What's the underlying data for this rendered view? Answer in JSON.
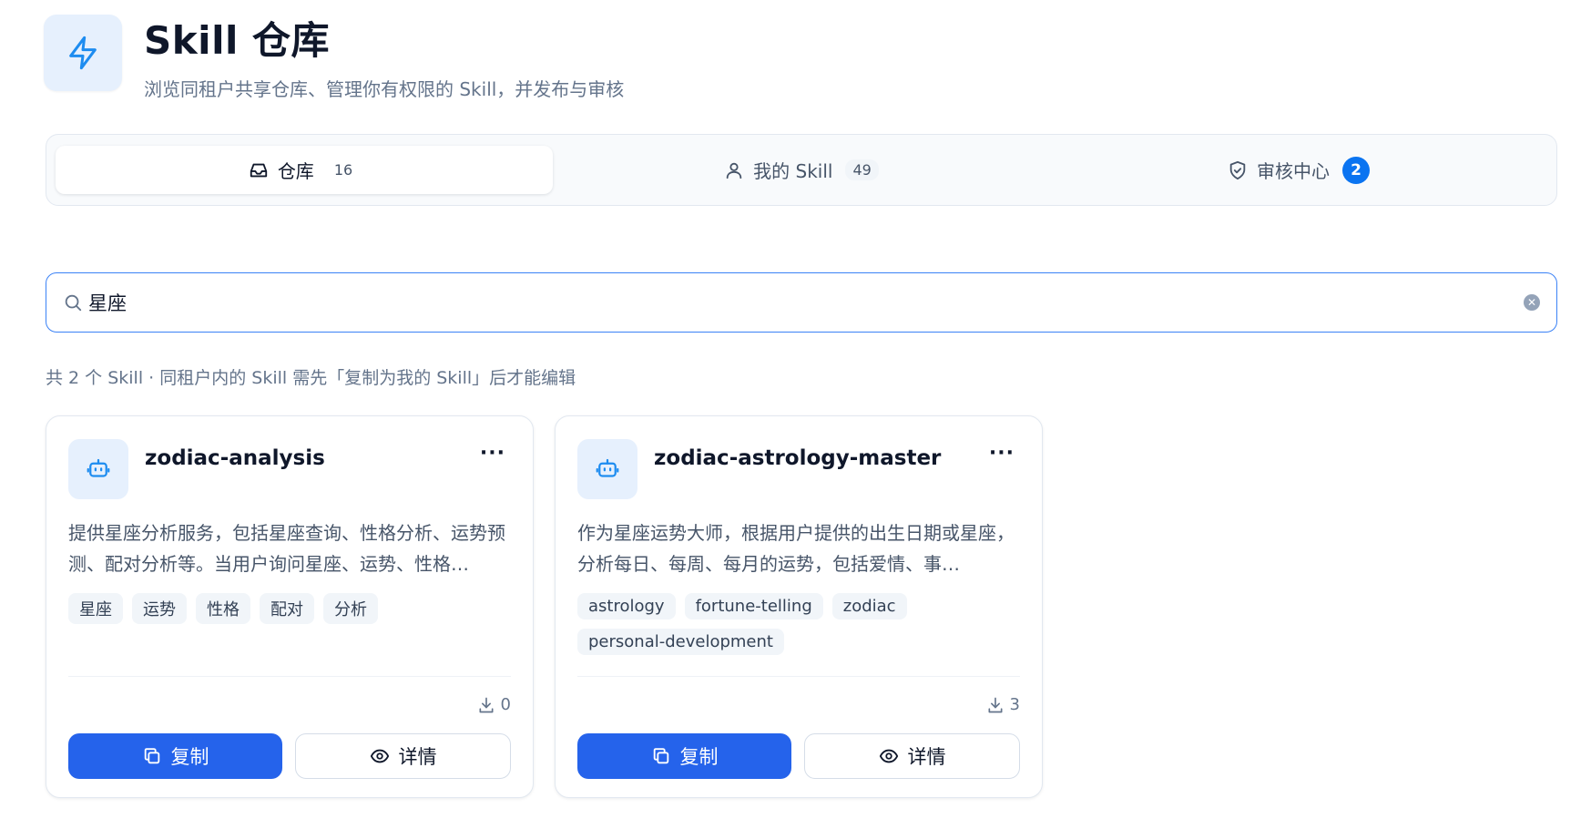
{
  "header": {
    "title": "Skill 仓库",
    "subtitle": "浏览同租户共享仓库、管理你有权限的 Skill，并发布与审核",
    "logo_icon": "lightning-icon"
  },
  "tabs": [
    {
      "label": "仓库",
      "count": "16",
      "icon": "inbox-icon",
      "active": true
    },
    {
      "label": "我的 Skill",
      "count": "49",
      "icon": "user-icon",
      "active": false
    },
    {
      "label": "审核中心",
      "count": "2",
      "icon": "shield-check-icon",
      "active": false
    }
  ],
  "search": {
    "value": "星座",
    "icon": "search-icon",
    "clear_icon": "clear-icon"
  },
  "summary": "共 2 个 Skill · 同租户内的 Skill 需先「复制为我的 Skill」后才能编辑",
  "cards": [
    {
      "name": "zodiac-analysis",
      "icon": "robot-icon",
      "more": "···",
      "description": "提供星座分析服务，包括星座查询、性格分析、运势预测、配对分析等。当用户询问星座、运势、性格…",
      "tags": [
        "星座",
        "运势",
        "性格",
        "配对",
        "分析"
      ],
      "downloads": "0",
      "copy_label": "复制",
      "detail_label": "详情"
    },
    {
      "name": "zodiac-astrology-master",
      "icon": "robot-icon",
      "more": "···",
      "description": "作为星座运势大师，根据用户提供的出生日期或星座，分析每日、每周、每月的运势，包括爱情、事…",
      "tags": [
        "astrology",
        "fortune-telling",
        "zodiac",
        "personal-development"
      ],
      "downloads": "3",
      "copy_label": "复制",
      "detail_label": "详情"
    }
  ],
  "colors": {
    "accent": "#2563eb",
    "badge": "#0b74f1",
    "icon_bg": "#e6f0fd"
  }
}
